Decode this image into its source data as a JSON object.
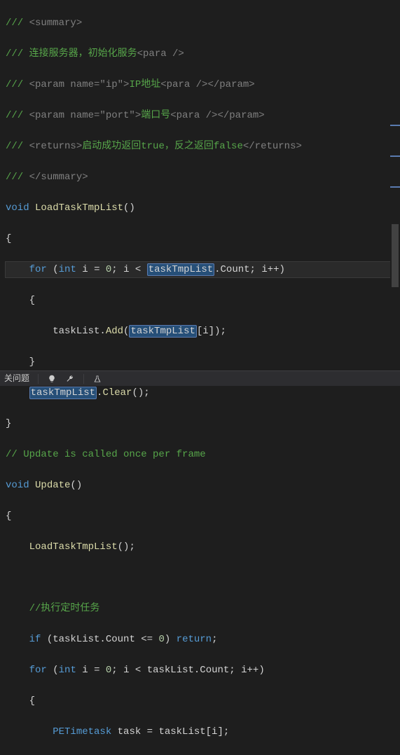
{
  "code": {
    "l1_a": "/// ",
    "l1_b": "<summary>",
    "l2_a": "/// 连接服务器，初始化服务",
    "l2_b": "<para />",
    "l3_a": "/// ",
    "l3_b": "<param name=\"ip\">",
    "l3_c": "IP地址",
    "l3_d": "<para />",
    "l3_e": "</param>",
    "l4_a": "/// ",
    "l4_b": "<param name=\"port\">",
    "l4_c": "端口号",
    "l4_d": "<para />",
    "l4_e": "</param>",
    "l5_a": "/// ",
    "l5_b": "<returns>",
    "l5_c": "启动成功返回true，反之返回false",
    "l5_d": "</returns>",
    "l6_a": "/// ",
    "l6_b": "</summary>",
    "l7_void": "void",
    "l7_name": " LoadTaskTmpList",
    "l7_paren": "()",
    "l8": "{",
    "l9_pre": "    ",
    "l9_for": "for",
    "l9_a": " (",
    "l9_int": "int",
    "l9_b": " i = ",
    "l9_zero": "0",
    "l9_c": "; i < ",
    "l9_hl": "taskTmpList",
    "l9_d": ".Count; i++)",
    "l10": "    {",
    "l11_pre": "        taskList.",
    "l11_add": "Add",
    "l11_a": "(",
    "l11_hl": "taskTmpList",
    "l11_b": "[i]);",
    "l12": "    }",
    "l13_pre": "    ",
    "l13_hl": "taskTmpList",
    "l13_a": ".",
    "l13_clear": "Clear",
    "l13_b": "();",
    "l14": "}",
    "l15": "// Update is called once per frame",
    "l16_void": "void",
    "l16_name": " Update",
    "l16_paren": "()",
    "l17": "{",
    "l18_pre": "    ",
    "l18_name": "LoadTaskTmpList",
    "l18_paren": "();",
    "l19": "",
    "l20_pre": "    ",
    "l20_txt": "//执行定时任务",
    "l21_pre": "    ",
    "l21_if": "if",
    "l21_a": " (taskList.Count <= ",
    "l21_zero": "0",
    "l21_b": ") ",
    "l21_ret": "return",
    "l21_c": ";",
    "l22_pre": "    ",
    "l22_for": "for",
    "l22_a": " (",
    "l22_int": "int",
    "l22_b": " i = ",
    "l22_zero": "0",
    "l22_c": "; i < taskList.Count; i++)",
    "l23": "    {",
    "l24_pre": "        ",
    "l24_type": "PETimetask",
    "l24_a": " task = taskList[i];"
  },
  "statusbar": {
    "label": "关问题"
  }
}
